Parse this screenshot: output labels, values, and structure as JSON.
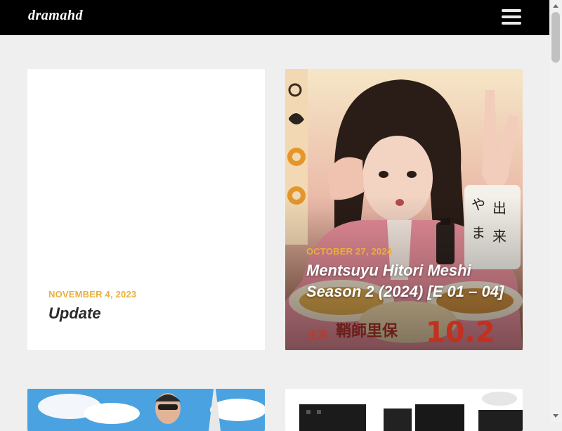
{
  "header": {
    "logo": "dramahd",
    "menu_icon": "hamburger-menu-icon"
  },
  "posts": [
    {
      "date": "NOVEMBER 4, 2023",
      "title": "Update"
    },
    {
      "date": "OCTOBER 27, 2024",
      "title": "Mentsuyu Hitori Meshi Season 2 (2024) [E 01 – 04]"
    }
  ],
  "poster_text": {
    "mentsuyu_number": "10.2",
    "mentsuyu_name": "鞘師里保",
    "mentsuyu_role": "主演"
  },
  "colors": {
    "header_bg": "#000000",
    "page_bg": "#efefef",
    "date_accent": "#e9b03b"
  }
}
